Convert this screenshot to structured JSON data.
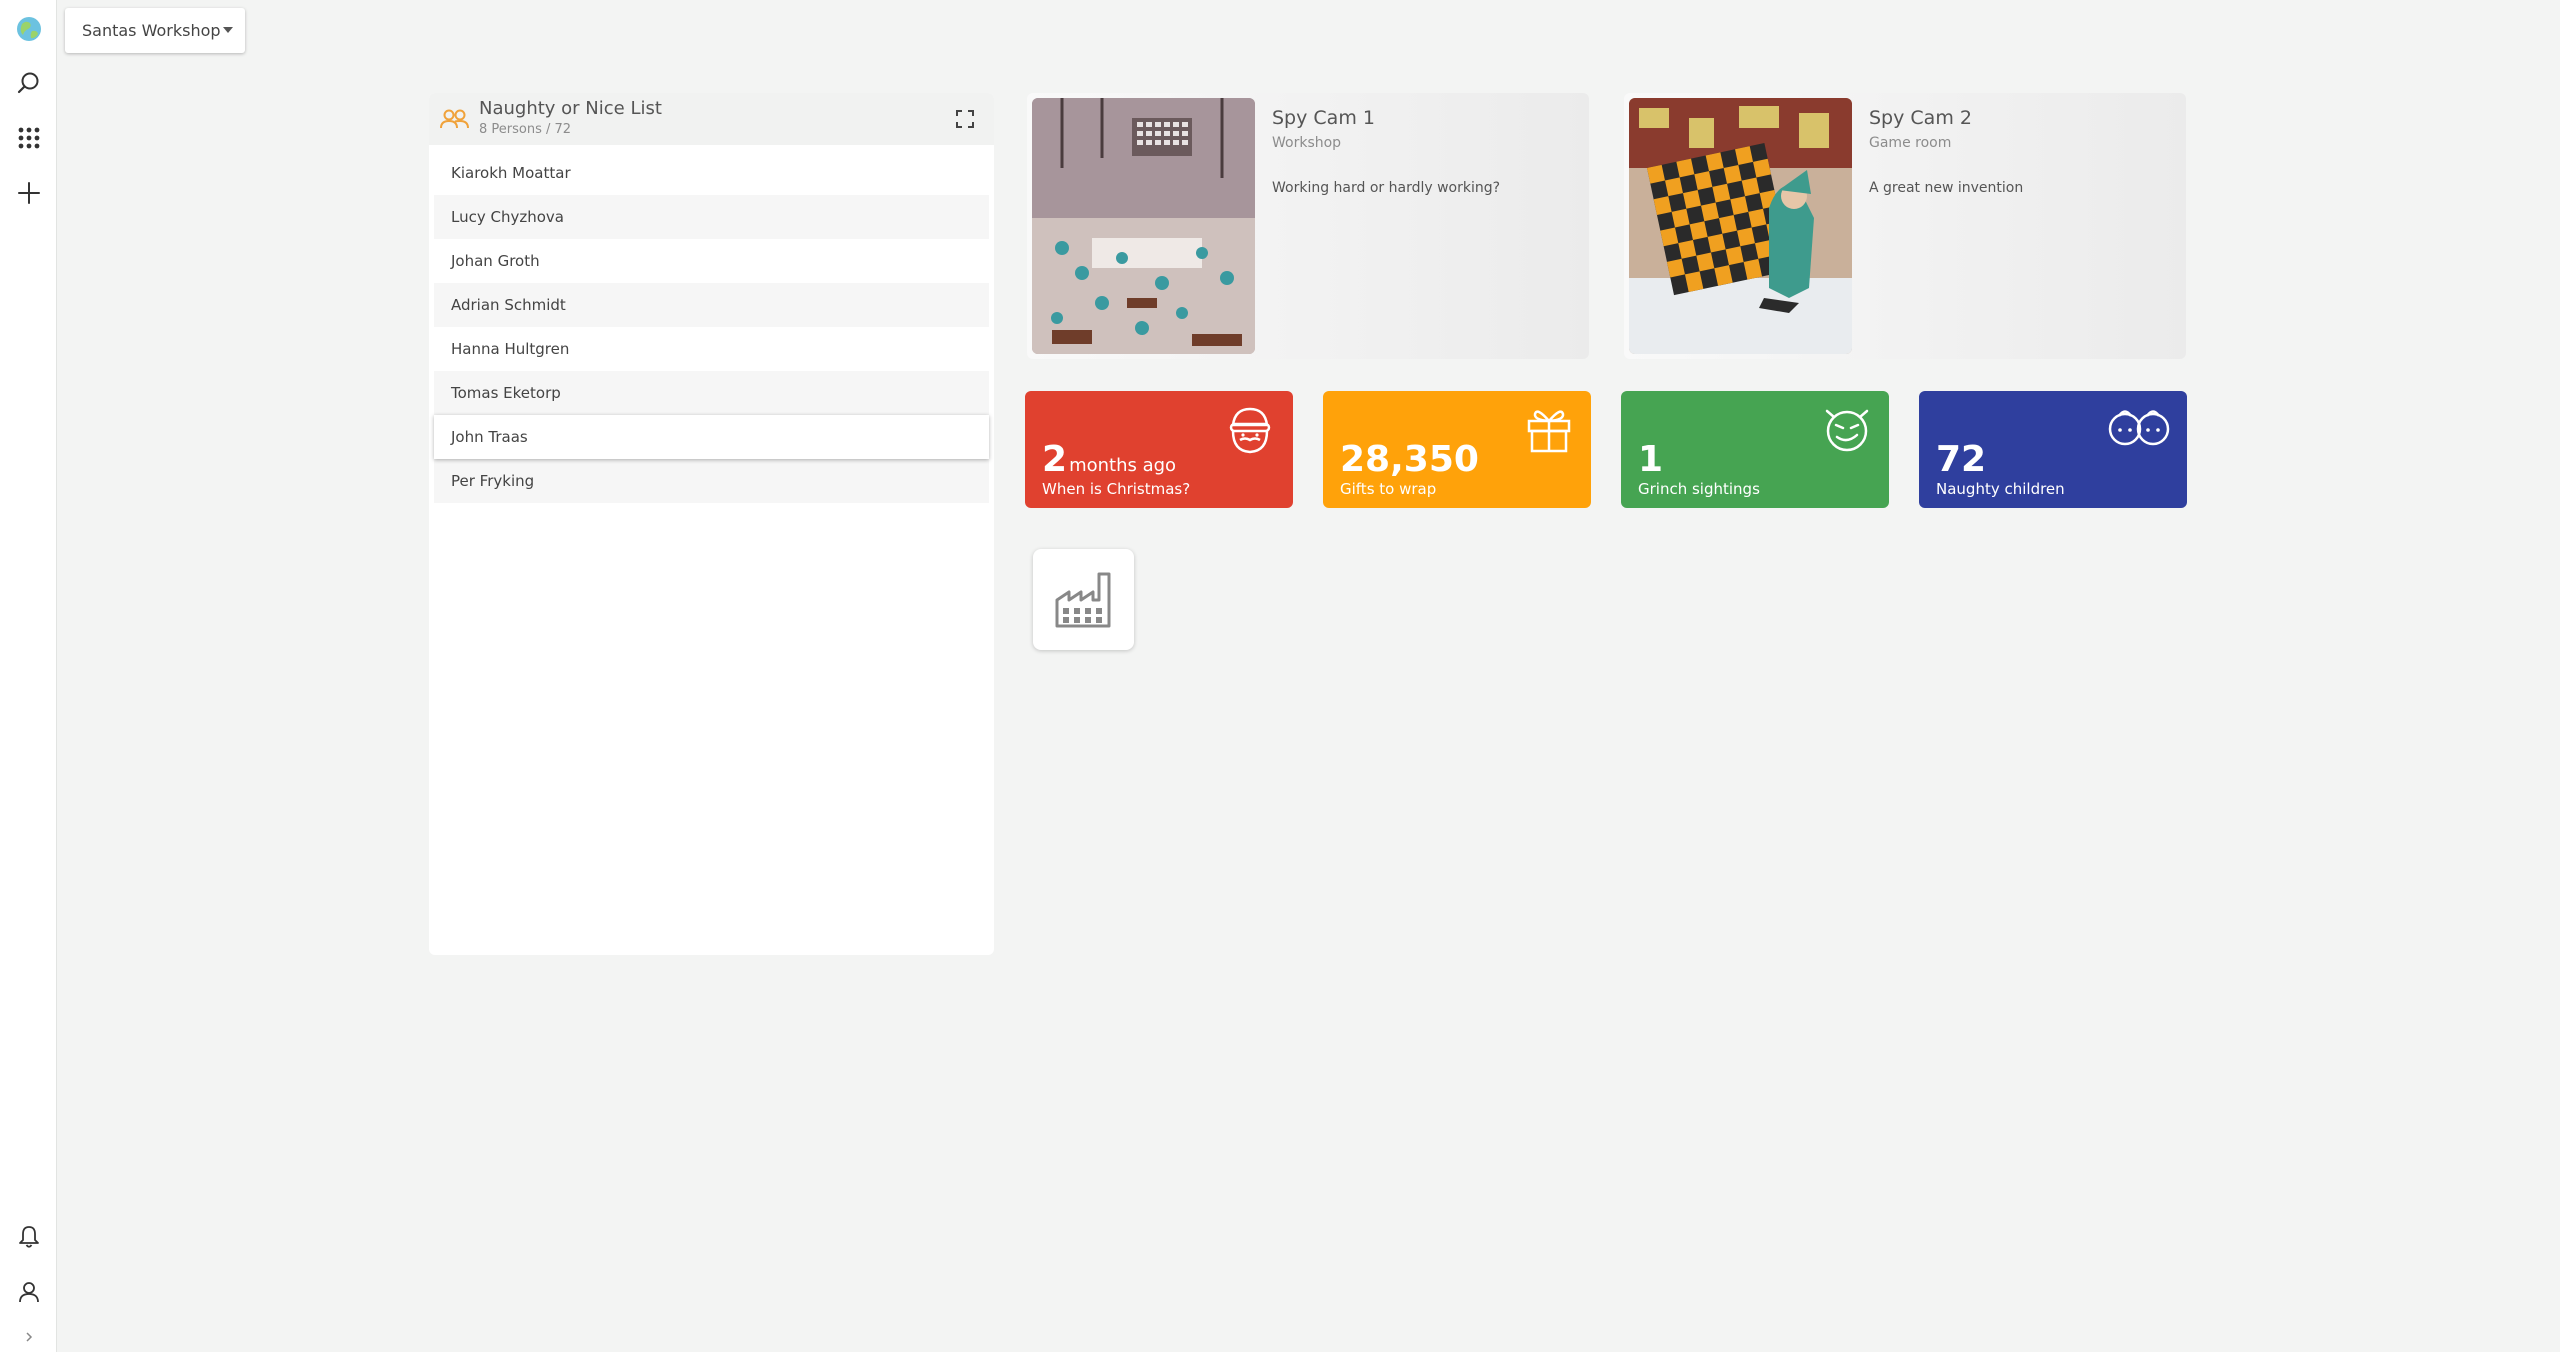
{
  "workspace": {
    "selected": "Santas Workshop"
  },
  "rail": {
    "top_icons": [
      "globe-icon",
      "search-icon",
      "apps-grid-icon",
      "add-icon"
    ],
    "bottom_icons": [
      "bell-icon",
      "user-icon",
      "chevron-right-icon"
    ]
  },
  "person_list": {
    "title": "Naughty or Nice List",
    "subtitle": "8 Persons / 72",
    "icon": "people-icon",
    "accent": "#f0a23a",
    "persons": [
      "Kiarokh Moattar",
      "Lucy Chyzhova",
      "Johan Groth",
      "Adrian Schmidt",
      "Hanna Hultgren",
      "Tomas Eketorp",
      "John Traas",
      "Per Fryking"
    ],
    "selected_index": 6
  },
  "cameras": [
    {
      "title": "Spy Cam 1",
      "location": "Workshop",
      "description": "Working hard or hardly working?"
    },
    {
      "title": "Spy Cam 2",
      "location": "Game room",
      "description": "A great new invention"
    }
  ],
  "tiles": [
    {
      "value": "2",
      "unit": "months ago",
      "label": "When is Christmas?",
      "color": "#e0412f",
      "icon": "santa-icon"
    },
    {
      "value": "28,350",
      "unit": "",
      "label": "Gifts to wrap",
      "color": "#ffa20a",
      "icon": "gift-icon"
    },
    {
      "value": "1",
      "unit": "",
      "label": "Grinch sightings",
      "color": "#46a452",
      "icon": "grinch-face-icon"
    },
    {
      "value": "72",
      "unit": "",
      "label": "Naughty children",
      "color": "#2f3f9e",
      "icon": "child-face-icon"
    }
  ],
  "app_tile": {
    "icon": "factory-icon"
  }
}
